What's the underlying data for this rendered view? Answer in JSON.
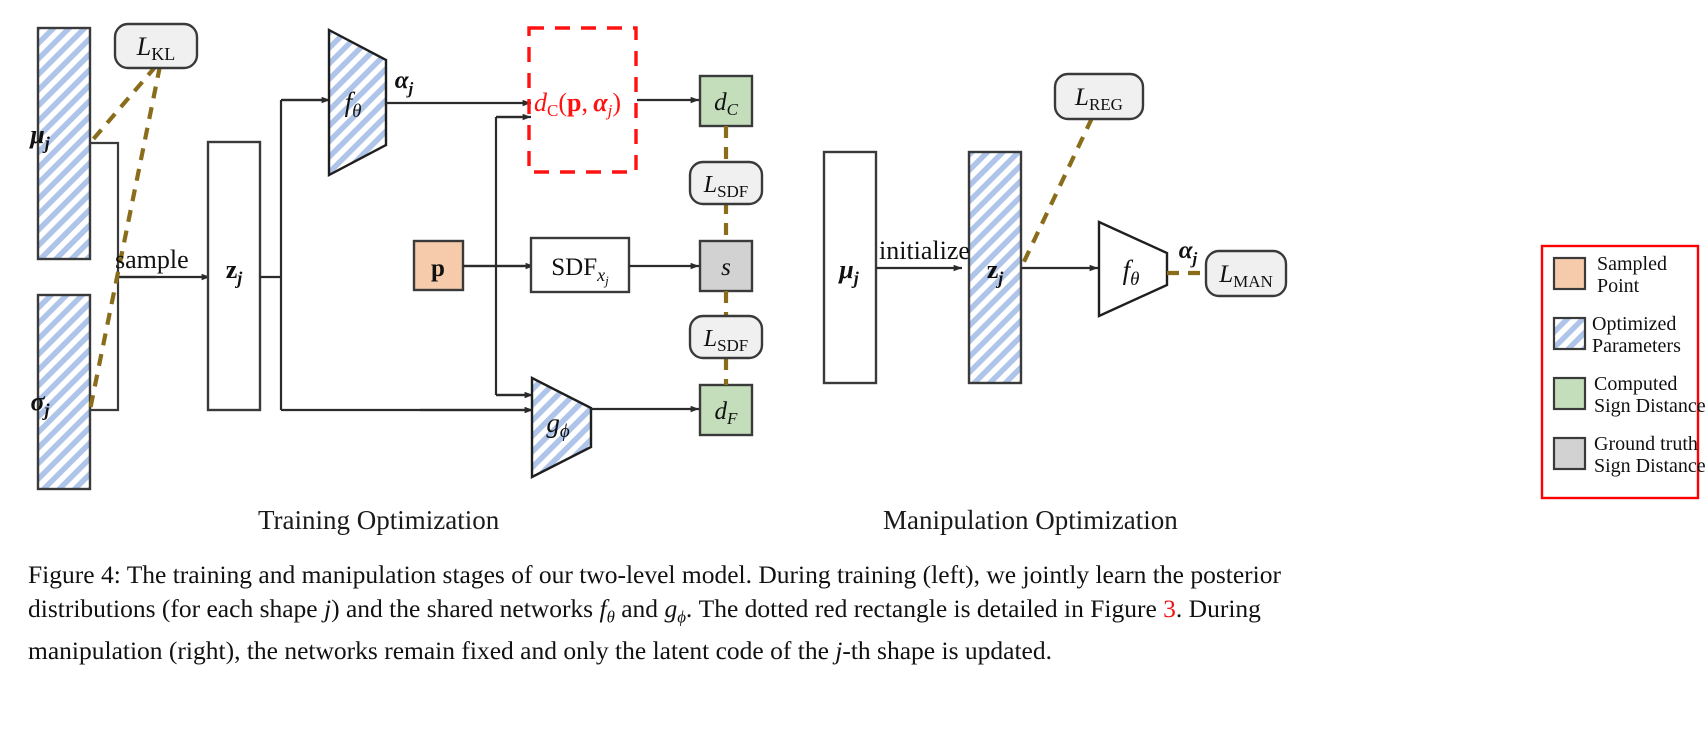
{
  "figure": {
    "number": "Figure 4",
    "stages": [
      {
        "id": "training",
        "label": "Training Optimization"
      },
      {
        "id": "manipulation",
        "label": "Manipulation Optimization"
      }
    ],
    "caption_lines": [
      "Figure 4: The training and manipulation stages of our two-level model. During training (left), we jointly learn the posterior",
      "distributions (for each shape j) and the shared networks fθ and gϕ. The dotted red rectangle is detailed in Figure 3. During",
      "manipulation (right), the networks remain fixed and only the latent code of the j-th shape is updated."
    ],
    "caption_red_token": "3"
  },
  "training": {
    "mu": {
      "label": "μ",
      "sub": "j",
      "style": "hatched"
    },
    "sigma": {
      "label": "σ",
      "sub": "j",
      "style": "hatched"
    },
    "z": {
      "label": "z",
      "sub": "j",
      "style": "plain"
    },
    "sample_label": "sample",
    "f_theta": {
      "label": "f",
      "sub": "θ",
      "style": "hatched"
    },
    "g_phi": {
      "label": "g",
      "sub": "ϕ",
      "style": "hatched"
    },
    "alpha": {
      "label": "α",
      "sub": "j"
    },
    "p": {
      "label": "p",
      "style": "sampled-point"
    },
    "sdf_box": {
      "label": "SDF",
      "sub": "xⱼ"
    },
    "red_expr": "dᴄ(p, αⱼ)",
    "red_expr_parts": {
      "d": "d",
      "dsub": "C",
      "open": "(",
      "p": "p",
      "comma": ", ",
      "alpha": "α",
      "asub": "j",
      "close": ")"
    },
    "d_c": {
      "label": "d",
      "sub": "C",
      "style": "computed"
    },
    "s": {
      "label": "s",
      "style": "ground-truth"
    },
    "d_f": {
      "label": "d",
      "sub": "F",
      "style": "computed"
    },
    "losses": [
      {
        "id": "L_KL",
        "label": "L",
        "sub": "KL"
      },
      {
        "id": "L_SDF_top",
        "label": "L",
        "sub": "SDF"
      },
      {
        "id": "L_SDF_bottom",
        "label": "L",
        "sub": "SDF"
      }
    ]
  },
  "manipulation": {
    "mu": {
      "label": "μ",
      "sub": "j",
      "style": "plain"
    },
    "z": {
      "label": "z",
      "sub": "j",
      "style": "hatched"
    },
    "initialize_label": "initialize",
    "f_theta": {
      "label": "f",
      "sub": "θ",
      "style": "plain"
    },
    "alpha": {
      "label": "α",
      "sub": "j"
    },
    "losses": [
      {
        "id": "L_REG",
        "label": "L",
        "sub": "REG"
      },
      {
        "id": "L_MAN",
        "label": "L",
        "sub": "MAN"
      }
    ]
  },
  "legend": {
    "border_color": "#ff0000",
    "items": [
      {
        "swatch": "sampled-point",
        "color": "#f6cbab",
        "line1": "Sampled",
        "line2": "Point"
      },
      {
        "swatch": "optimized",
        "color": "#aec4e8",
        "line1": "Optimized",
        "line2": "Parameters"
      },
      {
        "swatch": "computed",
        "color": "#c4debc",
        "line1": "Computed",
        "line2": "Sign Distance"
      },
      {
        "swatch": "ground-truth",
        "color": "#d2d2d2",
        "line1": "Ground truth",
        "line2": "Sign Distance"
      }
    ]
  },
  "colors": {
    "stroke": "#3a3a3a",
    "hatch": "#aec4e8",
    "loss_dash": "#8a6d1b",
    "red": "#ff1111",
    "computed_green": "#c4debc",
    "ground_gray": "#d2d2d2",
    "sampled_orange": "#f6cbab",
    "loss_fill": "#f0f0f0"
  }
}
